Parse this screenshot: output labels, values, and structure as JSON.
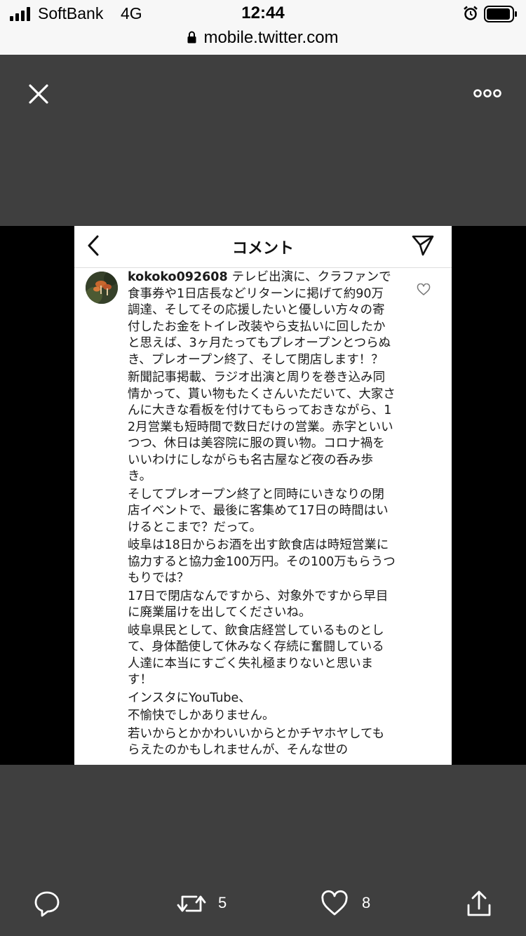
{
  "status_bar": {
    "carrier": "SoftBank",
    "network": "4G",
    "time": "12:44",
    "url": "mobile.twitter.com",
    "icons": [
      "signal-bars-icon",
      "alarm-icon",
      "battery-icon",
      "lock-icon"
    ]
  },
  "viewer": {
    "close_icon": "close-icon",
    "more_icon": "more-dots-icon"
  },
  "instagram": {
    "title": "コメント",
    "back_icon": "chevron-left-icon",
    "send_icon": "paper-plane-icon",
    "like_icon": "heart-outline-icon",
    "username": "kokoko092608",
    "paragraphs": [
      "テレビ出演に、クラファンで食事券や1日店長などリターンに掲げて約90万調達、そしてその応援したいと優しい方々の寄付したお金をトイレ改装やら支払いに回したかと思えば、3ヶ月たってもプレオープンとつらぬき、プレオープン終了、そして閉店します！？",
      "新聞記事掲載、ラジオ出演と周りを巻き込み同情かって、貰い物もたくさんいただいて、大家さんに大きな看板を付けてもらっておきながら、12月営業も短時間で数日だけの営業。赤字といいつつ、休日は美容院に服の買い物。コロナ禍をいいわけにしながらも名古屋など夜の呑み歩き。",
      "そしてプレオープン終了と同時にいきなりの閉店イベントで、最後に客集めて17日の時間はいけるとこまで？だって。",
      "岐阜は18日からお酒を出す飲食店は時短営業に協力すると協力金100万円。その100万もらうつもりでは？",
      "17日で閉店なんですから、対象外ですから早目に廃業届けを出してくださいね。",
      "岐阜県民として、飲食店経営しているものとして、身体酷使して休みなく存続に奮闘している人達に本当にすごく失礼極まりないと思います！",
      "インスタにYouTube、",
      "不愉快でしかありません。",
      "若いからとかかわいいからとかチヤホヤしてもらえたのかもしれませんが、そんな世の"
    ]
  },
  "actions": {
    "reply_icon": "reply-bubble-icon",
    "retweet_icon": "retweet-icon",
    "retweet_count": "5",
    "like_icon": "heart-icon",
    "like_count": "8",
    "share_icon": "share-icon"
  },
  "colors": {
    "background": "#3f3f3f",
    "status_bar": "#f7f7f7",
    "card": "#ffffff",
    "icon": "#ffffff"
  }
}
